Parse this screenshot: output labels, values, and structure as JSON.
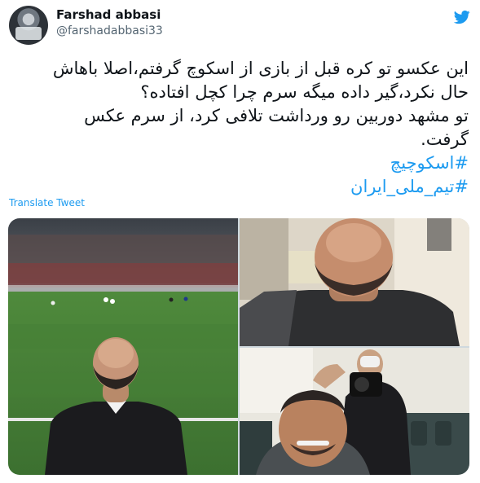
{
  "author": {
    "display_name": "Farshad abbasi",
    "handle": "@farshadabbasi33"
  },
  "tweet": {
    "lines": [
      "این عکسو تو کره قبل از بازی  از اسکوچ گرفتم،اصلا باهاش",
      "حال نکرد،گیر داده میگه سرم چرا کچل افتاده؟",
      "تو مشهد دوربین رو ورداشت تلافی کرد، از سرم عکس",
      "گرفت."
    ],
    "hashtags": [
      "#اسکوچیچ",
      "#تیم_ملی_ایران"
    ]
  },
  "translate_label": "Translate Tweet",
  "media": [
    {
      "icon": "stadium-photo"
    },
    {
      "icon": "bald-head-photo"
    },
    {
      "icon": "selfie-photo"
    }
  ],
  "colors": {
    "link": "#1d9bf0",
    "text": "#0f1419",
    "secondary": "#536471"
  }
}
